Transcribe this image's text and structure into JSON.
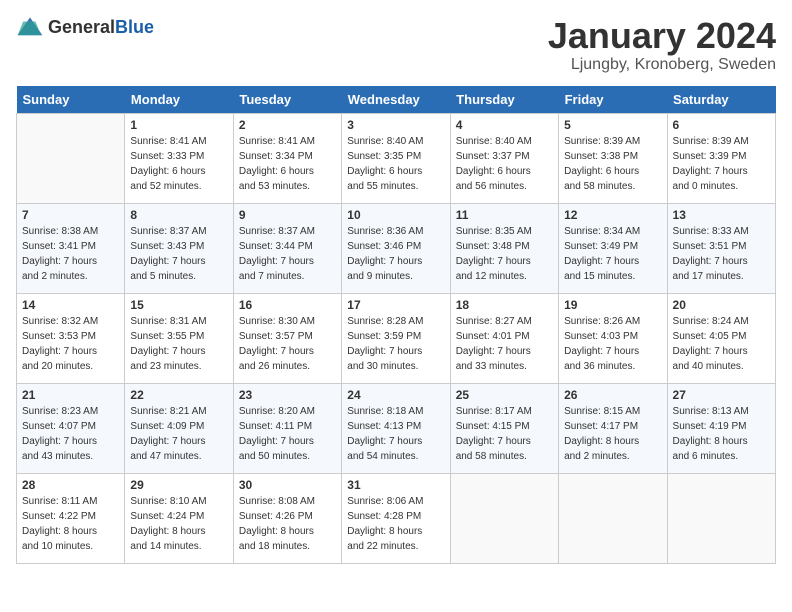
{
  "header": {
    "logo_general": "General",
    "logo_blue": "Blue",
    "month_title": "January 2024",
    "location": "Ljungby, Kronoberg, Sweden"
  },
  "days_of_week": [
    "Sunday",
    "Monday",
    "Tuesday",
    "Wednesday",
    "Thursday",
    "Friday",
    "Saturday"
  ],
  "weeks": [
    [
      {
        "day": "",
        "info": ""
      },
      {
        "day": "1",
        "info": "Sunrise: 8:41 AM\nSunset: 3:33 PM\nDaylight: 6 hours\nand 52 minutes."
      },
      {
        "day": "2",
        "info": "Sunrise: 8:41 AM\nSunset: 3:34 PM\nDaylight: 6 hours\nand 53 minutes."
      },
      {
        "day": "3",
        "info": "Sunrise: 8:40 AM\nSunset: 3:35 PM\nDaylight: 6 hours\nand 55 minutes."
      },
      {
        "day": "4",
        "info": "Sunrise: 8:40 AM\nSunset: 3:37 PM\nDaylight: 6 hours\nand 56 minutes."
      },
      {
        "day": "5",
        "info": "Sunrise: 8:39 AM\nSunset: 3:38 PM\nDaylight: 6 hours\nand 58 minutes."
      },
      {
        "day": "6",
        "info": "Sunrise: 8:39 AM\nSunset: 3:39 PM\nDaylight: 7 hours\nand 0 minutes."
      }
    ],
    [
      {
        "day": "7",
        "info": "Sunrise: 8:38 AM\nSunset: 3:41 PM\nDaylight: 7 hours\nand 2 minutes."
      },
      {
        "day": "8",
        "info": "Sunrise: 8:37 AM\nSunset: 3:43 PM\nDaylight: 7 hours\nand 5 minutes."
      },
      {
        "day": "9",
        "info": "Sunrise: 8:37 AM\nSunset: 3:44 PM\nDaylight: 7 hours\nand 7 minutes."
      },
      {
        "day": "10",
        "info": "Sunrise: 8:36 AM\nSunset: 3:46 PM\nDaylight: 7 hours\nand 9 minutes."
      },
      {
        "day": "11",
        "info": "Sunrise: 8:35 AM\nSunset: 3:48 PM\nDaylight: 7 hours\nand 12 minutes."
      },
      {
        "day": "12",
        "info": "Sunrise: 8:34 AM\nSunset: 3:49 PM\nDaylight: 7 hours\nand 15 minutes."
      },
      {
        "day": "13",
        "info": "Sunrise: 8:33 AM\nSunset: 3:51 PM\nDaylight: 7 hours\nand 17 minutes."
      }
    ],
    [
      {
        "day": "14",
        "info": "Sunrise: 8:32 AM\nSunset: 3:53 PM\nDaylight: 7 hours\nand 20 minutes."
      },
      {
        "day": "15",
        "info": "Sunrise: 8:31 AM\nSunset: 3:55 PM\nDaylight: 7 hours\nand 23 minutes."
      },
      {
        "day": "16",
        "info": "Sunrise: 8:30 AM\nSunset: 3:57 PM\nDaylight: 7 hours\nand 26 minutes."
      },
      {
        "day": "17",
        "info": "Sunrise: 8:28 AM\nSunset: 3:59 PM\nDaylight: 7 hours\nand 30 minutes."
      },
      {
        "day": "18",
        "info": "Sunrise: 8:27 AM\nSunset: 4:01 PM\nDaylight: 7 hours\nand 33 minutes."
      },
      {
        "day": "19",
        "info": "Sunrise: 8:26 AM\nSunset: 4:03 PM\nDaylight: 7 hours\nand 36 minutes."
      },
      {
        "day": "20",
        "info": "Sunrise: 8:24 AM\nSunset: 4:05 PM\nDaylight: 7 hours\nand 40 minutes."
      }
    ],
    [
      {
        "day": "21",
        "info": "Sunrise: 8:23 AM\nSunset: 4:07 PM\nDaylight: 7 hours\nand 43 minutes."
      },
      {
        "day": "22",
        "info": "Sunrise: 8:21 AM\nSunset: 4:09 PM\nDaylight: 7 hours\nand 47 minutes."
      },
      {
        "day": "23",
        "info": "Sunrise: 8:20 AM\nSunset: 4:11 PM\nDaylight: 7 hours\nand 50 minutes."
      },
      {
        "day": "24",
        "info": "Sunrise: 8:18 AM\nSunset: 4:13 PM\nDaylight: 7 hours\nand 54 minutes."
      },
      {
        "day": "25",
        "info": "Sunrise: 8:17 AM\nSunset: 4:15 PM\nDaylight: 7 hours\nand 58 minutes."
      },
      {
        "day": "26",
        "info": "Sunrise: 8:15 AM\nSunset: 4:17 PM\nDaylight: 8 hours\nand 2 minutes."
      },
      {
        "day": "27",
        "info": "Sunrise: 8:13 AM\nSunset: 4:19 PM\nDaylight: 8 hours\nand 6 minutes."
      }
    ],
    [
      {
        "day": "28",
        "info": "Sunrise: 8:11 AM\nSunset: 4:22 PM\nDaylight: 8 hours\nand 10 minutes."
      },
      {
        "day": "29",
        "info": "Sunrise: 8:10 AM\nSunset: 4:24 PM\nDaylight: 8 hours\nand 14 minutes."
      },
      {
        "day": "30",
        "info": "Sunrise: 8:08 AM\nSunset: 4:26 PM\nDaylight: 8 hours\nand 18 minutes."
      },
      {
        "day": "31",
        "info": "Sunrise: 8:06 AM\nSunset: 4:28 PM\nDaylight: 8 hours\nand 22 minutes."
      },
      {
        "day": "",
        "info": ""
      },
      {
        "day": "",
        "info": ""
      },
      {
        "day": "",
        "info": ""
      }
    ]
  ]
}
